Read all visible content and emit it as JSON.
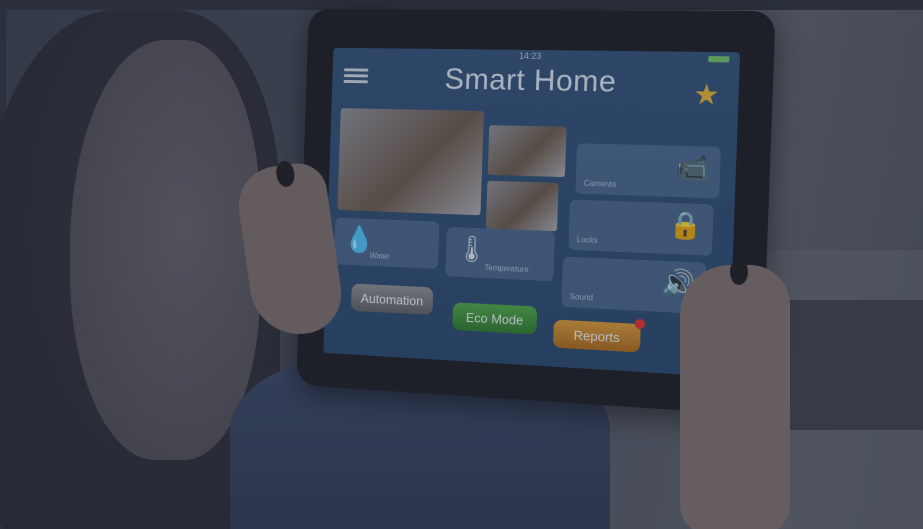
{
  "screen": {
    "time": "14:23",
    "title": "Smart Home",
    "tiles": {
      "cameras": "Cameras",
      "locks": "Locks",
      "water": "Water",
      "temperature": "Temperature",
      "sound": "Sound"
    },
    "buttons": {
      "automation": "Automation",
      "eco_mode": "Eco Mode",
      "reports": "Reports"
    }
  },
  "colors": {
    "screen_blue": "#2b4a70",
    "eco_green": "#3f9a3f",
    "reports_orange": "#c9852e",
    "star_gold": "#e2b33a",
    "badge_red": "#dd3333"
  }
}
